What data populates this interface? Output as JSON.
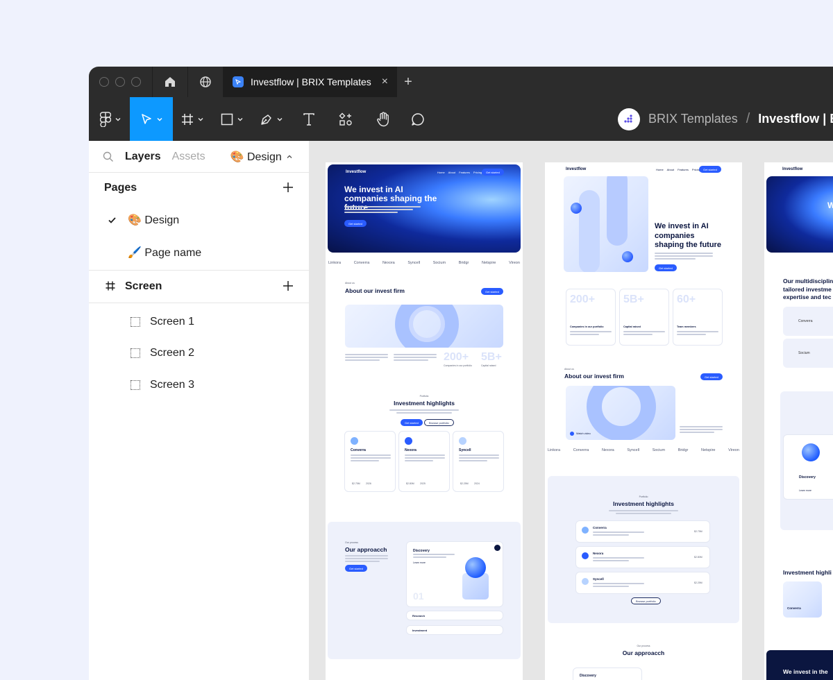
{
  "window": {
    "tab_title": "Investflow | BRIX Templates",
    "tab_close": "×",
    "tab_new": "+"
  },
  "toolbar": {
    "breadcrumb_team": "BRIX Templates",
    "breadcrumb_sep": "/",
    "breadcrumb_file": "Investflow | B",
    "tools": [
      "figma-menu",
      "move",
      "frame",
      "shape",
      "pen",
      "text",
      "resources",
      "hand",
      "comment"
    ],
    "accent": "#0d99ff"
  },
  "panel": {
    "tab_layers": "Layers",
    "tab_assets": "Assets",
    "tab_design": "🎨 Design",
    "pages_title": "Pages",
    "pages": [
      {
        "label": "🎨 Design",
        "selected": true
      },
      {
        "label": "🖌️ Page name",
        "selected": false
      }
    ],
    "screen_title": "Screen",
    "frames": [
      "Screen 1",
      "Screen 2",
      "Screen 3"
    ]
  },
  "canvas": {
    "brand": "Investflow",
    "nav": [
      "Home",
      "About",
      "Features",
      "Pricing"
    ],
    "nav_cta": "Get started",
    "hero_title": "We invest in AI companies shaping the future",
    "hero_title_short": "We invest in AI companies shaping the future",
    "hero_cta": "Get started",
    "logos": [
      "Linkora",
      "Converra",
      "Nexora",
      "Syncell",
      "Socium",
      "Bridgr",
      "Netspire",
      "Vireon"
    ],
    "about_eyebrow": "About us",
    "about_title": "About our invest firm",
    "about_cta": "Get started",
    "stat_1": "200+",
    "stat_2": "5B+",
    "stat_3": "60+",
    "stat_1_label": "Companies in our portfolio",
    "stat_2_label": "Capital raised",
    "stat_3_label": "Team members",
    "highlights_eyebrow": "Portfolio",
    "highlights_title": "Investment highlights",
    "highlights_cta": "Get started",
    "highlights_cta2": "Browse portfolio",
    "companies": [
      {
        "name": "Converra",
        "round": "$2.75M",
        "year": "2026"
      },
      {
        "name": "Nexora",
        "round": "$2.80M",
        "year": "2025"
      },
      {
        "name": "Syncell",
        "round": "$2.25M",
        "year": "2024"
      }
    ],
    "approach_eyebrow": "Our process",
    "approach_title": "Our approacch",
    "approach_title2": "Our approacch",
    "discovery": "Discovery",
    "learn_more": "Learn more",
    "step_num": "01",
    "research": "Research",
    "investment": "Investment",
    "watch_video": "Watch video",
    "browse_portfolio": "Browse portfolio",
    "ab3_hero": "We i",
    "ab3_multi": "Our multidisciplin tailored investme expertise and tec",
    "ab3_highlights": "Investment highli",
    "ab3_footer": "We invest in the"
  }
}
